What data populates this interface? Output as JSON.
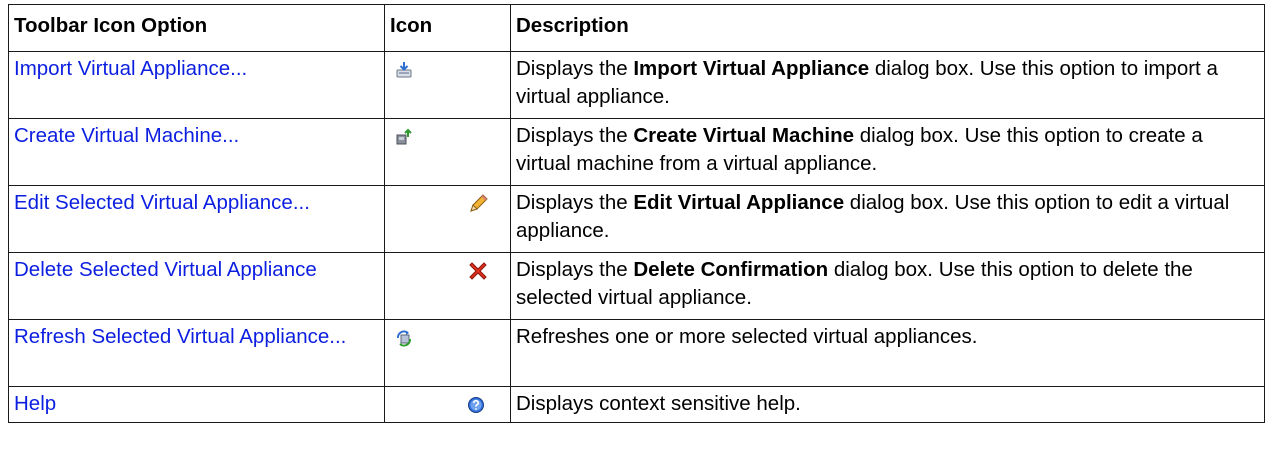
{
  "headers": {
    "option": "Toolbar Icon Option",
    "icon": "Icon",
    "description": "Description"
  },
  "rows": [
    {
      "option": "Import Virtual Appliance...",
      "icon": "import-appliance-icon",
      "desc_pre": "Displays the ",
      "desc_bold": "Import Virtual Appliance",
      "desc_post": " dialog box. Use this option to import a virtual appliance."
    },
    {
      "option": "Create Virtual Machine...",
      "icon": "create-vm-icon",
      "desc_pre": "Displays the ",
      "desc_bold": "Create Virtual Machine",
      "desc_post": " dialog box. Use this option to create a virtual machine from a virtual appliance."
    },
    {
      "option": "Edit Selected Virtual Appliance...",
      "icon": "pencil-icon",
      "desc_pre": "Displays the ",
      "desc_bold": "Edit Virtual Appliance",
      "desc_post": " dialog box. Use this option to edit a virtual appliance."
    },
    {
      "option": "Delete Selected Virtual Appliance",
      "icon": "delete-x-icon",
      "desc_pre": "Displays the ",
      "desc_bold": "Delete Confirmation",
      "desc_post": " dialog box. Use this option to delete the selected virtual appliance."
    },
    {
      "option": "Refresh Selected Virtual Appliance...",
      "icon": "refresh-icon",
      "desc_pre": "Refreshes one or more selected virtual appliances.",
      "desc_bold": "",
      "desc_post": ""
    },
    {
      "option": "Help",
      "icon": "help-icon",
      "desc_pre": "Displays context sensitive help.",
      "desc_bold": "",
      "desc_post": ""
    }
  ],
  "colors": {
    "link": "#0c1fe0",
    "border": "#1a1a1a",
    "delete_red": "#e0301e",
    "help_blue": "#2f6fd6"
  }
}
